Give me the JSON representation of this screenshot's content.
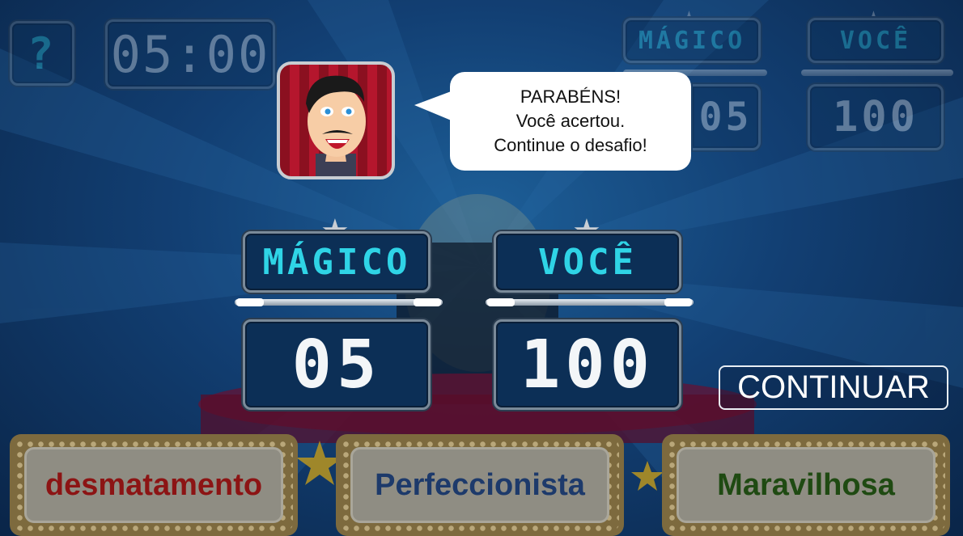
{
  "top_bar": {
    "help_label": "?",
    "timer": "05:00",
    "small_score": {
      "magico_label": "MÁGICO",
      "magico_value": "05",
      "voce_label": "VOCÊ",
      "voce_value": "100"
    }
  },
  "dialog": {
    "line1": "PARABÉNS!",
    "line2": "Você acertou.",
    "line3": "Continue o desafio!"
  },
  "scoreboard": {
    "magico_label": "MÁGICO",
    "magico_value": "05",
    "voce_label": "VOCÊ",
    "voce_value": "100"
  },
  "continue_button": "CONTINUAR",
  "answers": [
    {
      "label": "desmatamento",
      "color": "#8c1414"
    },
    {
      "label": "Perfeccionista",
      "color": "#1d3a6b"
    },
    {
      "label": "Maravilhosa",
      "color": "#1f4a12"
    }
  ],
  "colors": {
    "background": "#123f73",
    "lcd_label": "#2fd4e6",
    "lcd_number": "#f3f6f8"
  }
}
